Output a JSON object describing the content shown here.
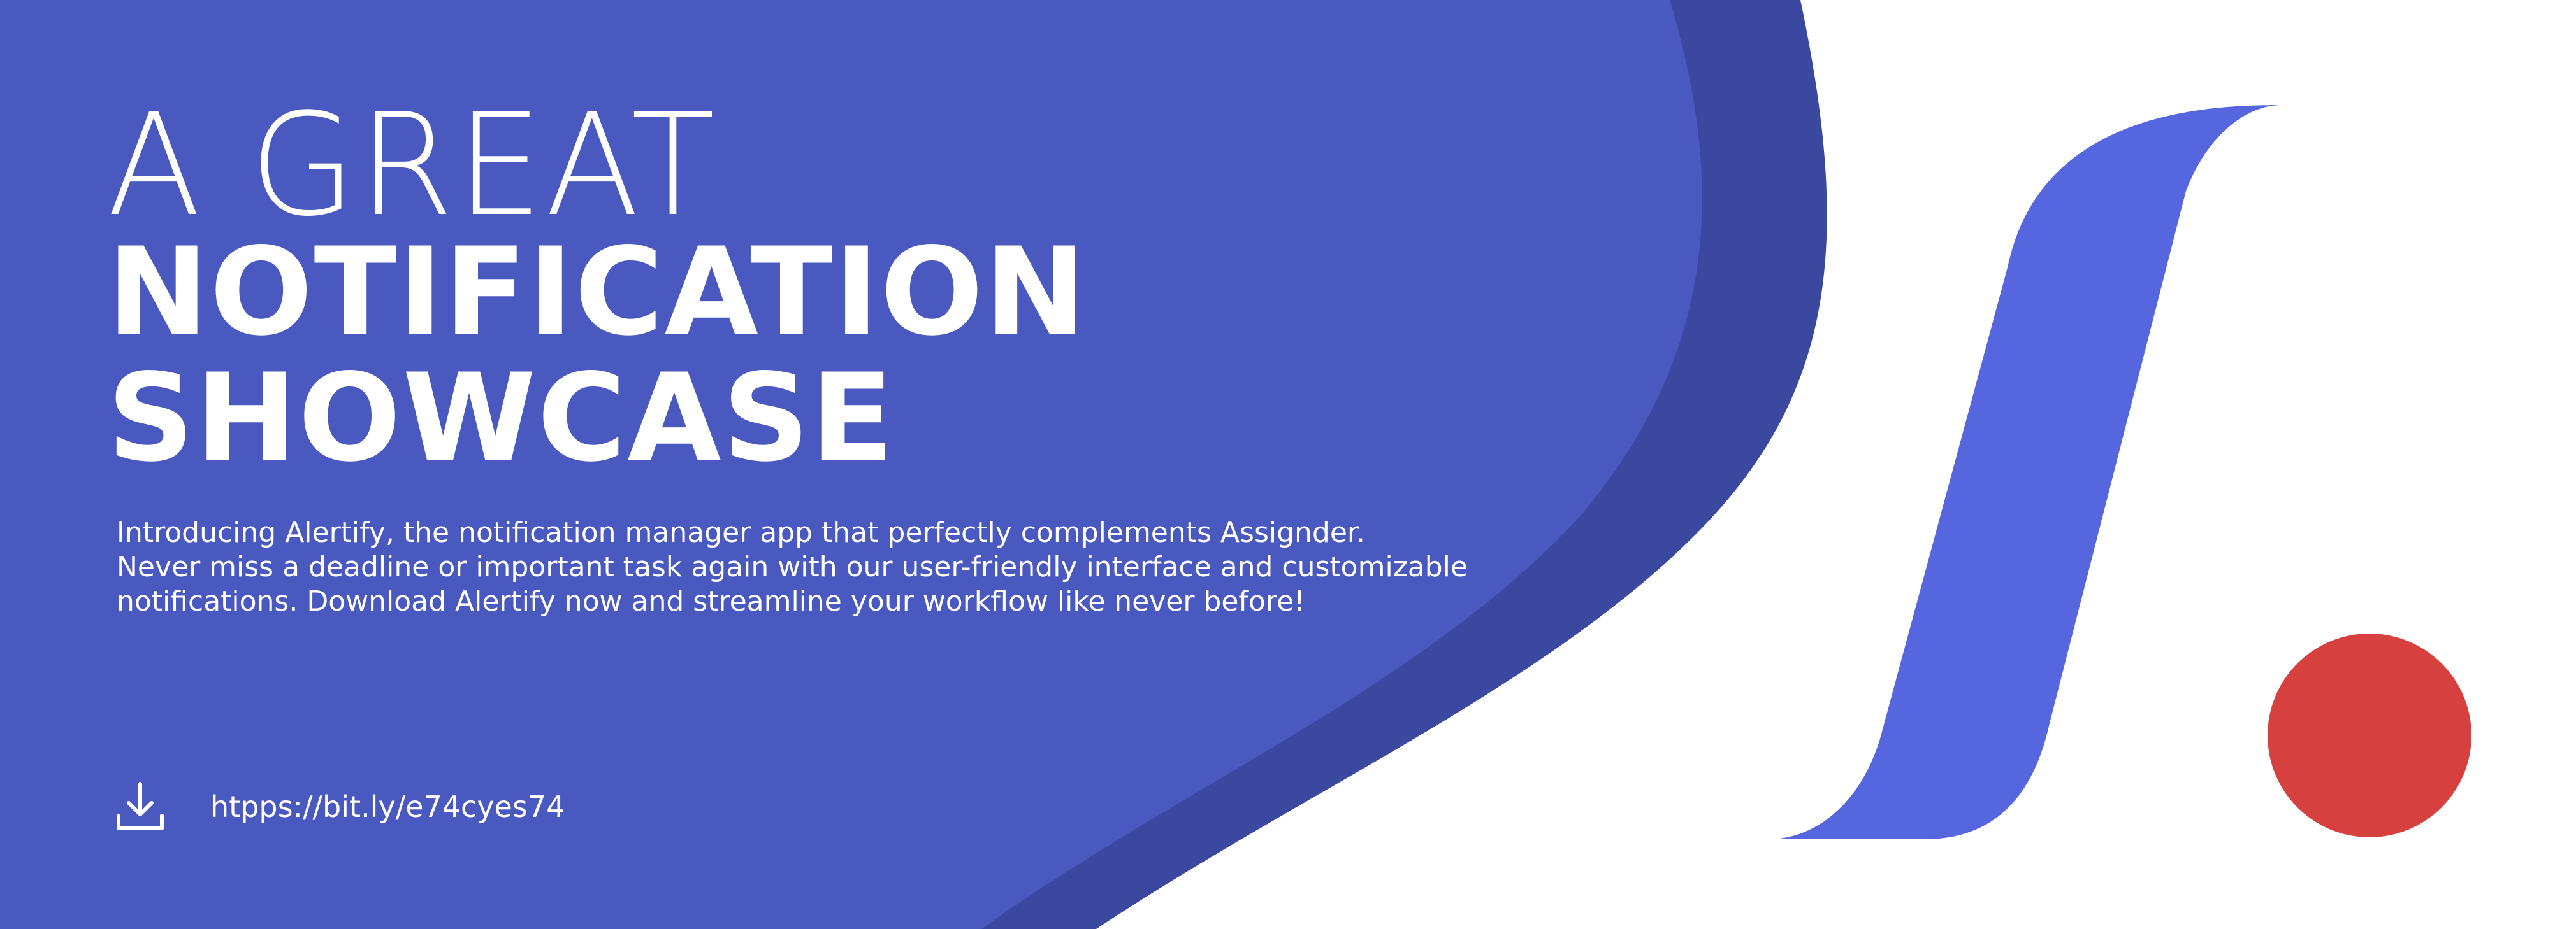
{
  "headline": {
    "line1": "A GREAT",
    "line2": "NOTIFICATION",
    "line3": "SHOWCASE"
  },
  "description": {
    "line1": "Introducing Alertify, the notification manager app that perfectly complements Assignder.",
    "line2": "Never miss a deadline or important task again with our user-friendly interface and customizable",
    "line3": "notifications. Download Alertify now and streamline your workflow like never before!"
  },
  "download": {
    "icon": "download-icon",
    "link_text": "htpps://bit.ly/e74cyes74"
  },
  "colors": {
    "panel_blue": "#4A59C0",
    "wave_dark_blue": "#3B48A0",
    "slash_blue": "#5566DF",
    "dot_red": "#D6403F",
    "background": "#FFFFFF",
    "text": "#FFFFFF"
  },
  "logo": {
    "shapes": [
      "slash",
      "dot"
    ]
  }
}
